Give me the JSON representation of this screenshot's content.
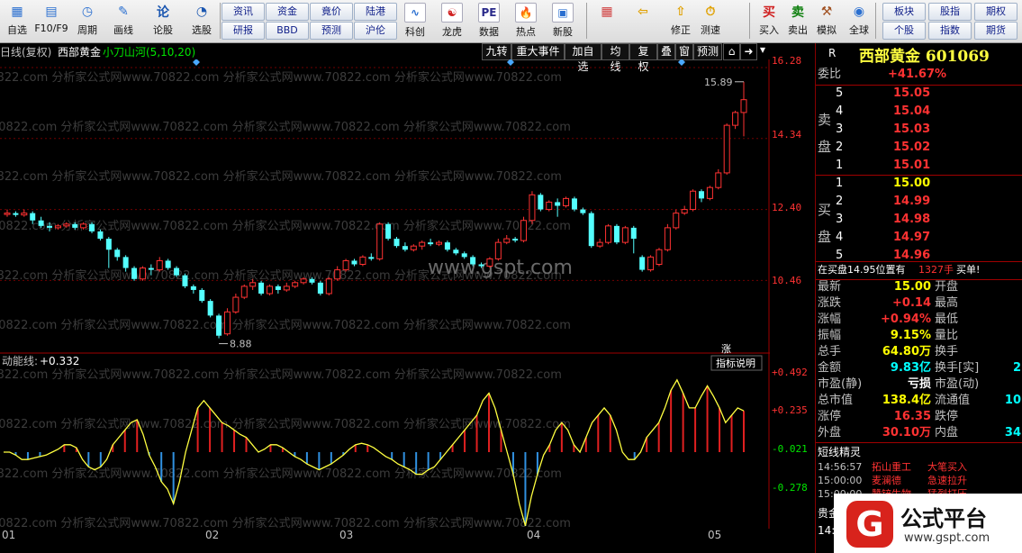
{
  "toolbar": {
    "items": [
      {
        "label": "自选",
        "icon": "watchlist-icon"
      },
      {
        "label": "F10/F9",
        "icon": "f10-icon"
      },
      {
        "label": "周期",
        "icon": "period-icon"
      },
      {
        "label": "画线",
        "icon": "draw-line-icon"
      },
      {
        "label": "论股",
        "icon": "discuss-icon"
      },
      {
        "label": "选股",
        "icon": "stock-picker-icon"
      }
    ],
    "grid": [
      [
        "资讯",
        "资金",
        "竟价",
        "陆港"
      ],
      [
        "研报",
        "BBD",
        "预测",
        "沪伦"
      ]
    ],
    "items2": [
      {
        "label": "科创",
        "icon": "kechuang-icon"
      },
      {
        "label": "龙虎",
        "icon": "dragon-tiger-icon"
      },
      {
        "label": "数据",
        "icon": "pe-data-icon"
      },
      {
        "label": "热点",
        "icon": "hotspot-icon"
      },
      {
        "label": "新股",
        "icon": "new-stock-icon"
      }
    ],
    "items3": [
      {
        "label": "",
        "icon": "color-grid-icon"
      },
      {
        "label": "",
        "icon": "back-arrow-icon"
      },
      {
        "label": "修正",
        "icon": "revise-icon"
      },
      {
        "label": "测速",
        "icon": "speedtest-icon"
      },
      {
        "label": "买入",
        "icon": "buy-icon"
      },
      {
        "label": "卖出",
        "icon": "sell-icon"
      },
      {
        "label": "模拟",
        "icon": "simulate-icon"
      },
      {
        "label": "全球",
        "icon": "global-icon"
      }
    ],
    "grid2": [
      [
        "板块",
        "股指",
        "期权"
      ],
      [
        "个股",
        "指数",
        "期货"
      ]
    ]
  },
  "chart_header": {
    "period": "日线(复权)",
    "stock": "西部黄金",
    "indicator": "小刀山河(5,10,20)",
    "buttons": [
      "九转",
      "重大事件",
      "加自选",
      "均线",
      "复权",
      "叠",
      "窗",
      "预测"
    ]
  },
  "price_axis": [
    "16.28",
    "14.34",
    "12.40",
    "10.46"
  ],
  "indicator_axis": [
    "+0.492",
    "+0.235",
    "-0.021",
    "-0.278"
  ],
  "indicator": {
    "name": "动能线",
    "value": "+0.332",
    "help": "指标说明",
    "up_label": "涨"
  },
  "annotations": {
    "high": "15.89",
    "low": "8.88"
  },
  "watermark": "www.gspt.com",
  "watermark_rows": "70822.com 分析家公式网www.70822.com 分析家公式网www.70822.com 分析家公式网www.70822.com",
  "x_axis": [
    "01",
    "02",
    "03",
    "04",
    "05"
  ],
  "chart_data": {
    "type": "candlestick",
    "ylim": [
      8.5,
      16.5
    ],
    "candles": [
      [
        12.3,
        12.3,
        12.2,
        12.4
      ],
      [
        12.3,
        12.25,
        12.2,
        12.35
      ],
      [
        12.25,
        12.3,
        12.2,
        12.4
      ],
      [
        12.3,
        12.1,
        12.0,
        12.35
      ],
      [
        12.1,
        11.95,
        11.9,
        12.2
      ],
      [
        11.95,
        11.9,
        11.8,
        12.05
      ],
      [
        11.9,
        11.95,
        11.85,
        12.0
      ],
      [
        11.95,
        12.0,
        11.9,
        12.05
      ],
      [
        12.0,
        11.9,
        11.85,
        12.05
      ],
      [
        11.9,
        12.0,
        11.85,
        12.05
      ],
      [
        12.0,
        11.8,
        11.75,
        12.05
      ],
      [
        11.8,
        11.6,
        11.55,
        11.85
      ],
      [
        11.6,
        11.3,
        10.8,
        11.65
      ],
      [
        11.3,
        11.1,
        11.0,
        11.35
      ],
      [
        11.1,
        10.8,
        10.7,
        11.15
      ],
      [
        10.8,
        10.5,
        10.45,
        10.85
      ],
      [
        10.5,
        10.8,
        10.45,
        10.85
      ],
      [
        10.8,
        10.75,
        10.6,
        10.9
      ],
      [
        10.75,
        11.0,
        10.7,
        11.1
      ],
      [
        11.0,
        10.8,
        10.75,
        11.05
      ],
      [
        10.8,
        10.6,
        10.55,
        10.85
      ],
      [
        10.6,
        10.3,
        10.25,
        10.65
      ],
      [
        10.3,
        10.2,
        10.1,
        10.35
      ],
      [
        10.2,
        9.9,
        9.85,
        10.25
      ],
      [
        9.9,
        9.5,
        9.45,
        9.95
      ],
      [
        9.5,
        8.95,
        8.88,
        9.55
      ],
      [
        9.0,
        9.6,
        8.95,
        9.7
      ],
      [
        9.6,
        10.0,
        9.55,
        10.1
      ],
      [
        10.0,
        10.3,
        9.95,
        10.35
      ],
      [
        10.3,
        10.4,
        10.2,
        10.5
      ],
      [
        10.4,
        10.1,
        10.05,
        10.45
      ],
      [
        10.1,
        10.3,
        10.05,
        10.35
      ],
      [
        10.3,
        10.2,
        10.1,
        10.35
      ],
      [
        10.2,
        10.3,
        10.15,
        10.4
      ],
      [
        10.3,
        10.4,
        10.25,
        10.45
      ],
      [
        10.4,
        10.5,
        10.35,
        10.55
      ],
      [
        10.5,
        10.4,
        10.35,
        10.55
      ],
      [
        10.4,
        10.1,
        10.05,
        10.45
      ],
      [
        10.1,
        10.5,
        10.05,
        10.55
      ],
      [
        10.5,
        10.75,
        10.45,
        10.85
      ],
      [
        10.75,
        11.0,
        10.7,
        11.05
      ],
      [
        11.0,
        10.9,
        10.85,
        11.05
      ],
      [
        10.9,
        11.1,
        10.85,
        11.15
      ],
      [
        11.1,
        11.05,
        11.0,
        11.2
      ],
      [
        11.05,
        12.0,
        11.0,
        12.05
      ],
      [
        12.0,
        11.6,
        11.55,
        12.05
      ],
      [
        11.6,
        11.4,
        11.35,
        11.65
      ],
      [
        11.4,
        11.3,
        11.25,
        11.5
      ],
      [
        11.3,
        11.4,
        11.25,
        11.45
      ],
      [
        11.4,
        11.5,
        11.3,
        11.55
      ],
      [
        11.5,
        11.45,
        11.4,
        11.6
      ],
      [
        11.45,
        11.5,
        11.4,
        11.55
      ],
      [
        11.5,
        11.3,
        11.25,
        11.55
      ],
      [
        11.3,
        11.2,
        11.15,
        11.35
      ],
      [
        11.2,
        11.1,
        11.05,
        11.25
      ],
      [
        11.1,
        10.9,
        10.85,
        11.15
      ],
      [
        10.9,
        10.85,
        10.8,
        10.95
      ],
      [
        10.85,
        11.05,
        10.8,
        11.1
      ],
      [
        11.05,
        11.5,
        11.0,
        11.6
      ],
      [
        11.5,
        11.6,
        11.45,
        11.7
      ],
      [
        11.6,
        11.55,
        11.5,
        11.65
      ],
      [
        11.55,
        12.1,
        11.5,
        12.2
      ],
      [
        12.1,
        12.8,
        12.0,
        12.9
      ],
      [
        12.8,
        12.4,
        12.35,
        12.85
      ],
      [
        12.4,
        12.6,
        12.35,
        12.65
      ],
      [
        12.6,
        12.5,
        12.2,
        12.7
      ],
      [
        12.5,
        12.7,
        12.45,
        12.75
      ],
      [
        12.7,
        12.4,
        12.35,
        12.75
      ],
      [
        12.4,
        12.3,
        12.25,
        12.45
      ],
      [
        12.3,
        11.4,
        11.35,
        12.35
      ],
      [
        11.4,
        11.5,
        11.35,
        11.6
      ],
      [
        11.5,
        11.95,
        11.45,
        12.0
      ],
      [
        11.95,
        11.5,
        11.45,
        12.0
      ],
      [
        11.5,
        11.9,
        11.45,
        11.95
      ],
      [
        11.9,
        11.6,
        11.2,
        11.95
      ],
      [
        11.1,
        10.75,
        10.7,
        11.15
      ],
      [
        10.75,
        11.1,
        10.7,
        11.15
      ],
      [
        10.9,
        11.3,
        10.85,
        11.35
      ],
      [
        11.3,
        11.9,
        11.25,
        12.0
      ],
      [
        11.9,
        12.3,
        11.85,
        12.4
      ],
      [
        12.3,
        12.4,
        12.25,
        12.5
      ],
      [
        12.4,
        12.9,
        12.35,
        12.95
      ],
      [
        12.9,
        12.7,
        12.6,
        12.95
      ],
      [
        12.7,
        13.0,
        12.65,
        13.05
      ],
      [
        13.0,
        13.4,
        12.95,
        13.5
      ],
      [
        13.4,
        14.7,
        13.35,
        14.75
      ],
      [
        14.7,
        15.05,
        14.6,
        15.1
      ],
      [
        15.05,
        15.4,
        14.4,
        15.89
      ]
    ],
    "osc": [
      0.0,
      0.0,
      -0.02,
      -0.05,
      -0.05,
      -0.04,
      -0.03,
      -0.02,
      0.0,
      0.02,
      0.05,
      0.05,
      0.03,
      -0.05,
      -0.1,
      -0.12,
      -0.1,
      -0.05,
      0.05,
      0.1,
      0.15,
      0.2,
      0.22,
      0.12,
      -0.02,
      -0.1,
      -0.2,
      -0.25,
      -0.35,
      -0.2,
      0.0,
      0.15,
      0.3,
      0.35,
      0.3,
      0.25,
      0.2,
      0.18,
      0.15,
      0.12,
      0.1,
      0.05,
      0.0,
      0.02,
      0.05,
      0.05,
      0.03,
      0.0,
      -0.03,
      -0.05,
      -0.08,
      -0.1,
      -0.12,
      -0.1,
      -0.08,
      -0.05,
      -0.02,
      0.02,
      0.05,
      0.06,
      0.05,
      0.03,
      0.0,
      -0.03,
      -0.05,
      -0.08,
      -0.1,
      -0.12,
      -0.15,
      -0.15,
      -0.12,
      -0.1,
      -0.05,
      0.0,
      0.05,
      0.1,
      0.15,
      0.2,
      0.25,
      0.35,
      0.4,
      0.3,
      0.15,
      0.0,
      -0.15,
      -0.35,
      -0.5,
      -0.3,
      -0.15,
      -0.02,
      0.05,
      0.15,
      0.2,
      0.15,
      0.05,
      0.0,
      0.1,
      0.2,
      0.25,
      0.3,
      0.25,
      0.15,
      0.0,
      -0.05,
      -0.05,
      0.0,
      0.1,
      0.15,
      0.2,
      0.3,
      0.42,
      0.49,
      0.4,
      0.3,
      0.3,
      0.38,
      0.45,
      0.38,
      0.3,
      0.2,
      0.25,
      0.3,
      0.28
    ]
  },
  "right_panel": {
    "stock_title": "西部黄金 601069",
    "weibi_label": "委比",
    "weibi_value": "+41.67%",
    "r_label": "R",
    "sell_label": "卖盘",
    "buy_label": "买盘",
    "sell": [
      {
        "lvl": "5",
        "price": "15.05"
      },
      {
        "lvl": "4",
        "price": "15.04"
      },
      {
        "lvl": "3",
        "price": "15.03"
      },
      {
        "lvl": "2",
        "price": "15.02"
      },
      {
        "lvl": "1",
        "price": "15.01"
      }
    ],
    "buy": [
      {
        "lvl": "1",
        "price": "15.00"
      },
      {
        "lvl": "2",
        "price": "14.99"
      },
      {
        "lvl": "3",
        "price": "14.98"
      },
      {
        "lvl": "4",
        "price": "14.97"
      },
      {
        "lvl": "5",
        "price": "14.96"
      }
    ],
    "bid_note": "在买盘14.95位置有",
    "bid_qty": "1327手",
    "bid_action": "买单!",
    "stats": [
      {
        "l": "最新",
        "v": "15.00",
        "v_cls": "yel",
        "r": "开盘"
      },
      {
        "l": "涨跌",
        "v": "+0.14",
        "v_cls": "red",
        "r": "最高"
      },
      {
        "l": "涨幅",
        "v": "+0.94%",
        "v_cls": "red",
        "r": "最低"
      },
      {
        "l": "振幅",
        "v": "9.15%",
        "v_cls": "yel",
        "r": "量比"
      },
      {
        "l": "总手",
        "v": "64.80万",
        "v_cls": "yel",
        "r": "换手"
      },
      {
        "l": "金额",
        "v": "9.83亿",
        "v_cls": "cyan",
        "r": "换手[实]",
        "extra": "2"
      },
      {
        "l": "市盈(静)",
        "v": "亏损",
        "v_cls": "wht",
        "r": "市盈(动)"
      },
      {
        "l": "总市值",
        "v": "138.4亿",
        "v_cls": "yel",
        "r": "流通值",
        "extra": "10"
      },
      {
        "l": "涨停",
        "v": "16.35",
        "v_cls": "red",
        "r": "跌停"
      },
      {
        "l": "外盘",
        "v": "30.10万",
        "v_cls": "red",
        "r": "内盘",
        "extra": "34"
      }
    ],
    "short_title": "短线精灵",
    "short": [
      {
        "t": "14:56:57",
        "s": "拓山重工",
        "e": "大笔买入"
      },
      {
        "t": "15:00:00",
        "s": "麦澜德",
        "e": "急速拉升"
      },
      {
        "t": "15:00:00",
        "s": "赞锌生物",
        "e": "猛烈打压"
      }
    ],
    "tab_label": "贵金",
    "time_fragment": "14:",
    "logo_text": "公式平台",
    "logo_url": "www.gspt.com"
  }
}
